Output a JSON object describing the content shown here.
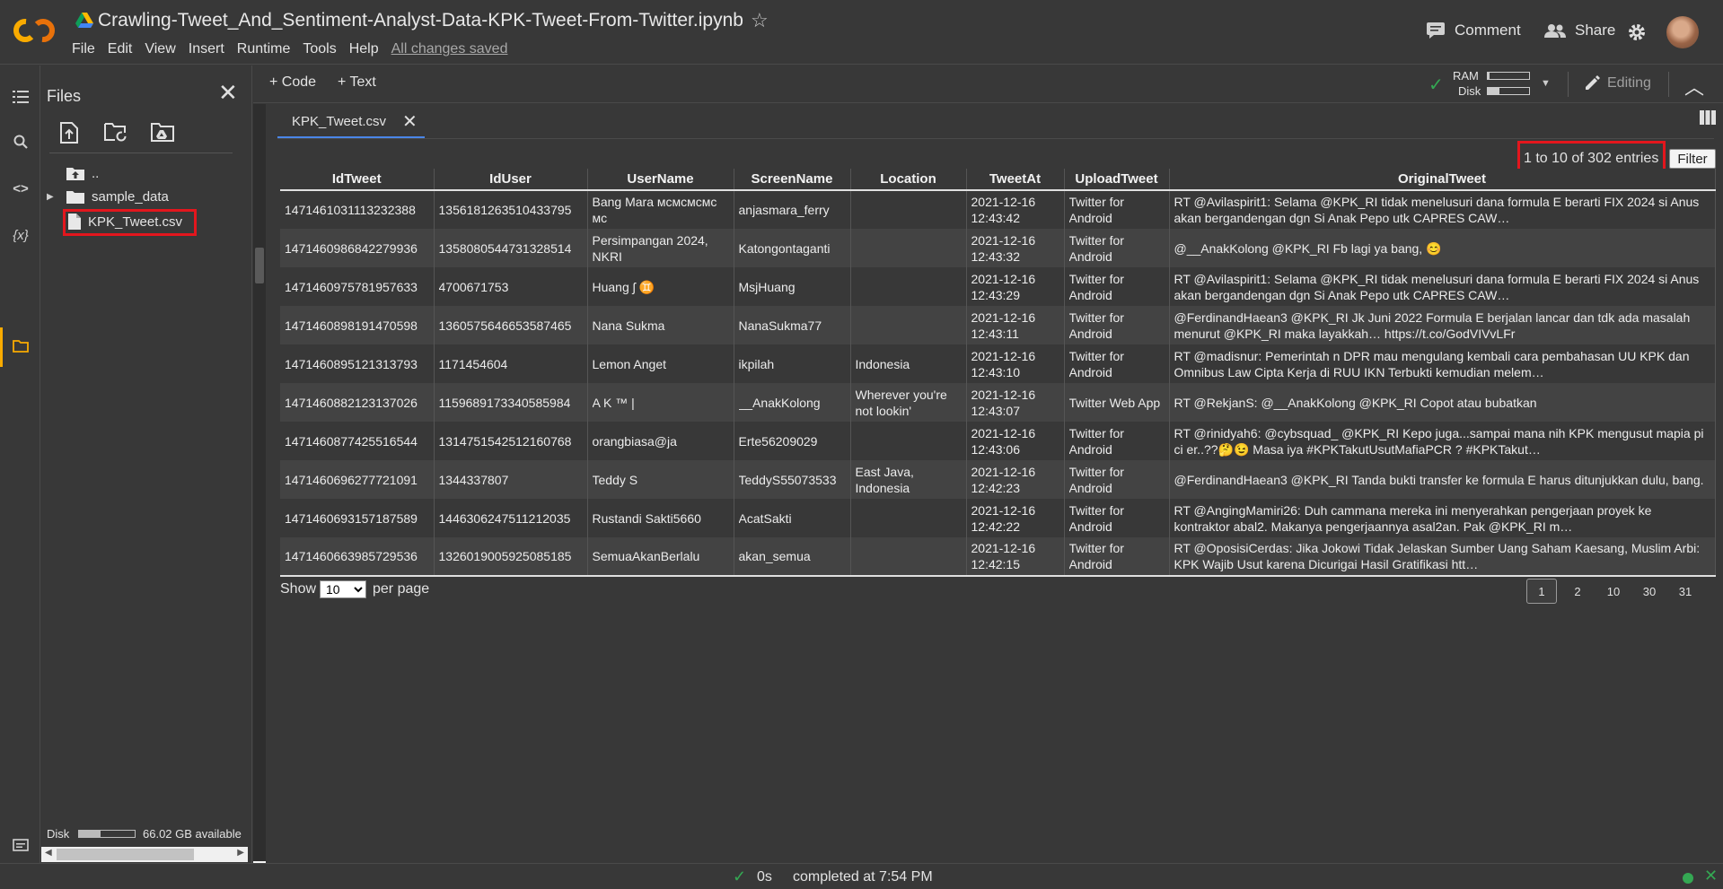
{
  "header": {
    "title": "Crawling-Tweet_And_Sentiment-Analyst-Data-KPK-Tweet-From-Twitter.ipynb",
    "menu": [
      "File",
      "Edit",
      "View",
      "Insert",
      "Runtime",
      "Tools",
      "Help"
    ],
    "save_status": "All changes saved",
    "comment_label": "Comment",
    "share_label": "Share"
  },
  "files_pane": {
    "title": "Files",
    "tree": [
      {
        "label": "..",
        "icon": "folder-up-icon"
      },
      {
        "label": "sample_data",
        "icon": "folder-icon"
      },
      {
        "label": "KPK_Tweet.csv",
        "icon": "file-icon",
        "highlighted": true
      }
    ],
    "disk_label": "Disk",
    "disk_available": "66.02 GB available",
    "disk_used_fraction": 0.38
  },
  "toolbar": {
    "code_label": "+ Code",
    "text_label": "+ Text",
    "ram_label": "RAM",
    "disk_label": "Disk",
    "ram_fraction": 0.05,
    "disk_fraction": 0.28,
    "editing_label": "Editing"
  },
  "viewer": {
    "tab_label": "KPK_Tweet.csv",
    "entries_text": "1 to 10 of 302 entries",
    "filter_label": "Filter",
    "columns": [
      "IdTweet",
      "IdUser",
      "UserName",
      "ScreenName",
      "Location",
      "TweetAt",
      "UploadTweet",
      "OriginalTweet"
    ],
    "rows": [
      [
        "1471461031113232388",
        "1356181263510433795",
        "Bang Mara ᴍᴄᴍᴄᴍᴄᴍᴄ ᴍᴄ",
        "anjasmara_ferry",
        "",
        "2021-12-16 12:43:42",
        "Twitter for Android",
        "RT @Avilaspirit1: Selama @KPK_RI tidak menelusuri dana formula E berarti FIX 2024 si Anus akan bergandengan dgn Si Anak Pepo utk CAPRES CAW…"
      ],
      [
        "1471460986842279936",
        "1358080544731328514",
        "Persimpangan 2024, NKRI",
        "Katongontaganti",
        "",
        "2021-12-16 12:43:32",
        "Twitter for Android",
        "@__AnakKolong @KPK_RI Fb lagi ya bang, 😊"
      ],
      [
        "1471460975781957633",
        "4700671753",
        "Huang ʃ ♊",
        "MsjHuang",
        "",
        "2021-12-16 12:43:29",
        "Twitter for Android",
        "RT @Avilaspirit1: Selama @KPK_RI tidak menelusuri dana formula E berarti FIX 2024 si Anus akan bergandengan dgn Si Anak Pepo utk CAPRES CAW…"
      ],
      [
        "1471460898191470598",
        "1360575646653587465",
        "Nana Sukma",
        "NanaSukma77",
        "",
        "2021-12-16 12:43:11",
        "Twitter for Android",
        "@FerdinandHaean3 @KPK_RI Jk Juni 2022 Formula E berjalan lancar dan tdk ada masalah menurut @KPK_RI maka layakkah… https://t.co/GodVIVvLFr"
      ],
      [
        "1471460895121313793",
        "1171454604",
        "Lemon Anget",
        "ikpilah",
        "Indonesia",
        "2021-12-16 12:43:10",
        "Twitter for Android",
        "RT @madisnur: Pemerintah n DPR mau mengulang kembali cara pembahasan UU KPK dan Omnibus Law Cipta Kerja di RUU IKN Terbukti kemudian melem…"
      ],
      [
        "1471460882123137026",
        "1159689173340585984",
        "A K ™ |",
        "__AnakKolong",
        "Wherever you're not lookin'",
        "2021-12-16 12:43:07",
        "Twitter Web App",
        "RT @RekjanS: @__AnakKolong @KPK_RI Copot atau bubatkan"
      ],
      [
        "1471460877425516544",
        "1314751542512160768",
        "orangbiasa@ja",
        "Erte56209029",
        "",
        "2021-12-16 12:43:06",
        "Twitter for Android",
        "RT @rinidyah6: @cybsquad_ @KPK_RI Kepo juga...sampai mana nih KPK mengusut mapia pi ci er..??🤔😉 Masa iya #KPKTakutUsutMafiaPCR ? #KPKTakut…"
      ],
      [
        "1471460696277721091",
        "1344337807",
        "Teddy S",
        "TeddyS55073533",
        "East Java, Indonesia",
        "2021-12-16 12:42:23",
        "Twitter for Android",
        "@FerdinandHaean3 @KPK_RI Tanda bukti transfer ke formula E harus ditunjukkan dulu, bang."
      ],
      [
        "1471460693157187589",
        "1446306247511212035",
        "Rustandi Sakti5660",
        "AcatSakti",
        "",
        "2021-12-16 12:42:22",
        "Twitter for Android",
        "RT @AngingMamiri26: Duh cammana mereka ini menyerahkan pengerjaan proyek ke kontraktor abal2. Makanya pengerjaannya asal2an. Pak @KPK_RI m…"
      ],
      [
        "1471460663985729536",
        "1326019005925085185",
        "SemuaAkanBerlalu",
        "akan_semua",
        "",
        "2021-12-16 12:42:15",
        "Twitter for Android",
        "RT @OposisiCerdas: Jika Jokowi Tidak Jelaskan Sumber Uang Saham Kaesang, Muslim Arbi: KPK Wajib Usut karena Dicurigai Hasil Gratifikasi htt…"
      ]
    ],
    "show_label": "Show",
    "per_page_value": "10",
    "per_page_label": "per page",
    "pages": [
      "1",
      "2",
      "10",
      "30",
      "31"
    ],
    "active_page": "1"
  },
  "status_bar": {
    "elapsed": "0s",
    "message": "completed at 7:54 PM"
  },
  "colors": {
    "highlight_box": "#e3161d",
    "accent_green": "#34a853",
    "tab_underline": "#4a86e8",
    "logo_orange": "#f9ab00"
  }
}
